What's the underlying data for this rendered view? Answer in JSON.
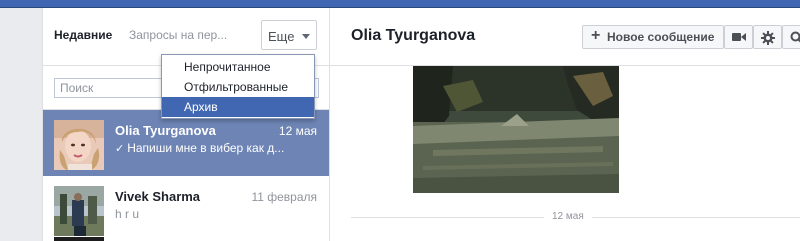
{
  "inbox": {
    "tab_recent": "Недавние",
    "tab_requests": "Запросы на пер...",
    "more_label": "Еще",
    "search_placeholder": "Поиск"
  },
  "dropdown": {
    "items": [
      {
        "label": "Непрочитанное",
        "selected": false
      },
      {
        "label": "Отфильтрованные",
        "selected": false
      },
      {
        "label": "Архив",
        "selected": true
      }
    ]
  },
  "conversations": [
    {
      "name": "Olia Tyurganova",
      "date": "12 мая",
      "snippet": "Напиши мне в вибер как д...",
      "active": true,
      "read_check": "✓"
    },
    {
      "name": "Vivek Sharma",
      "date": "11 февраля",
      "snippet": "h r u",
      "active": false
    }
  ],
  "chat": {
    "title": "Olia Tyurganova",
    "new_message_label": "Новое сообщение",
    "date_divider": "12 мая"
  },
  "colors": {
    "brand": "#4267b2",
    "active_row": "#6d84b4",
    "muted_text": "#90949c"
  },
  "icons": [
    "plus-icon",
    "video-camera-icon",
    "gear-icon",
    "search-icon",
    "chevron-down-icon",
    "check-icon"
  ]
}
